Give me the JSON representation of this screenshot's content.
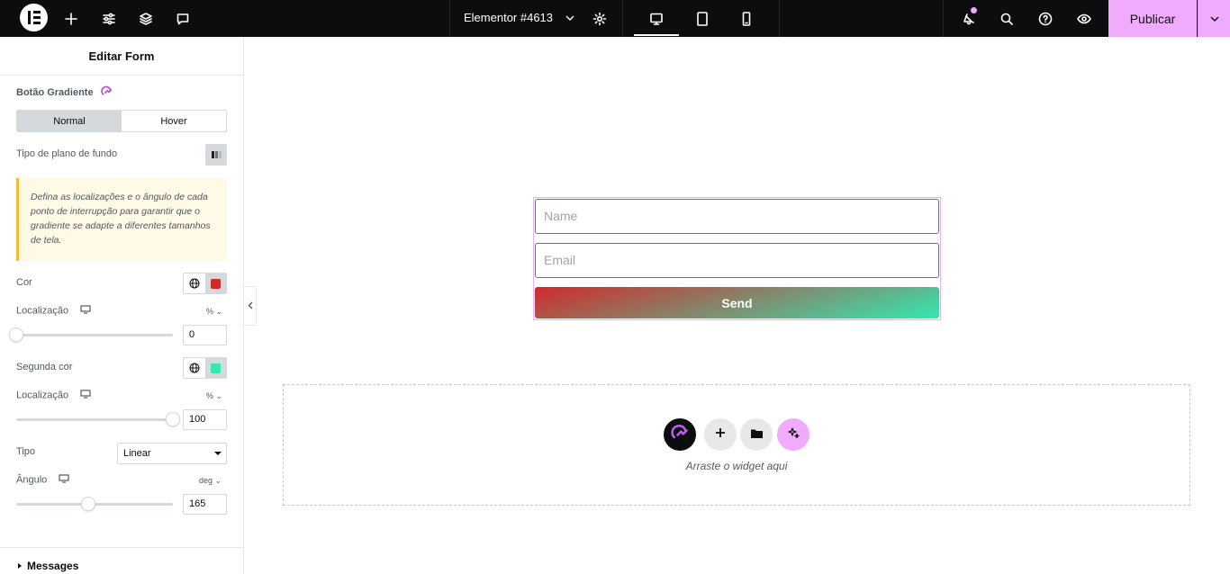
{
  "topbar": {
    "document_title": "Elementor #4613",
    "publish_label": "Publicar",
    "icons": [
      "elementor-logo-icon",
      "add-icon",
      "settings-sliders-icon",
      "layers-icon",
      "comment-icon",
      "gear-icon",
      "desktop-icon",
      "tablet-icon",
      "mobile-icon",
      "notifications-icon",
      "search-icon",
      "help-icon",
      "preview-eye-icon",
      "chevron-down-icon"
    ]
  },
  "panel": {
    "header_title": "Editar Form",
    "section_title": "Botão Gradiente",
    "tabs": [
      {
        "label": "Normal",
        "active": true
      },
      {
        "label": "Hover",
        "active": false
      }
    ],
    "background_type_label": "Tipo de plano de fundo",
    "notice": "Defina as localizações e o ângulo de cada ponto de interrupção para garantir que o gradiente se adapte a diferentes tamanhos de tela.",
    "color_label": "Cor",
    "color_value": "#d12a2a",
    "location_label": "Localização",
    "location_unit": "%",
    "location_value": "0",
    "second_color_label": "Segunda cor",
    "second_color_value": "#34e8b0",
    "location2_label": "Localização",
    "location2_unit": "%",
    "location2_value": "100",
    "type_label": "Tipo",
    "type_value": "Linear",
    "angle_label": "Ângulo",
    "angle_unit": "deg",
    "angle_value": "165",
    "messages_label": "Messages"
  },
  "canvas": {
    "name_placeholder": "Name",
    "email_placeholder": "Email",
    "send_label": "Send",
    "dropzone_text": "Arraste o widget aqui"
  },
  "colors": {
    "accent": "#f0abfc",
    "topbar_bg": "#0c0d0e",
    "gradient_start": "#d12a2a",
    "gradient_end": "#34e8b0"
  }
}
